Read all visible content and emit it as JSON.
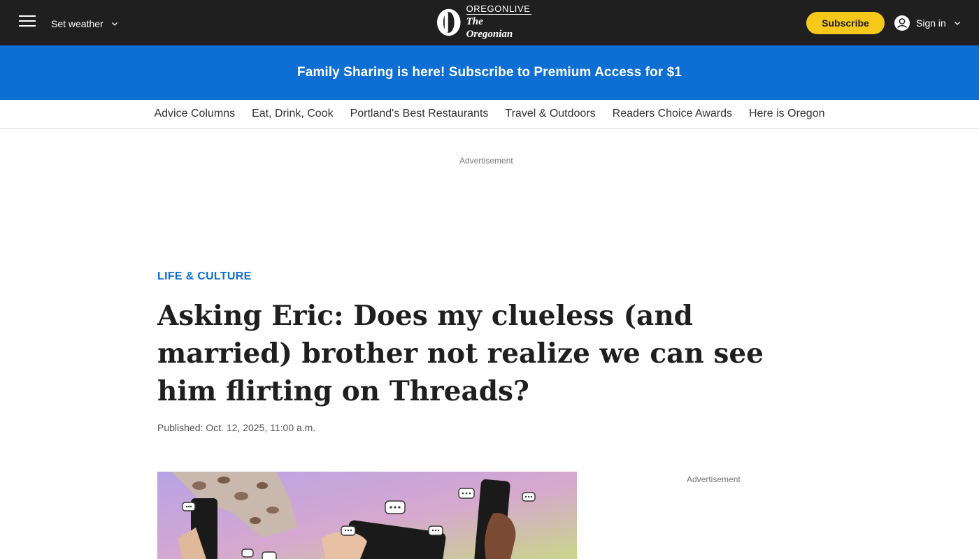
{
  "header": {
    "weather_label": "Set weather",
    "logo_top": "OREGONLIVE",
    "logo_bottom": "The Oregonian",
    "subscribe_label": "Subscribe",
    "signin_label": "Sign in"
  },
  "promo": {
    "text": "Family Sharing is here! Subscribe to Premium Access for $1"
  },
  "nav": {
    "items": [
      {
        "label": "Advice Columns"
      },
      {
        "label": "Eat, Drink, Cook"
      },
      {
        "label": "Portland's Best Restaurants"
      },
      {
        "label": "Travel & Outdoors"
      },
      {
        "label": "Readers Choice Awards"
      },
      {
        "label": "Here is Oregon"
      }
    ]
  },
  "ads": {
    "top_label": "Advertisement",
    "side_label": "Advertisement"
  },
  "article": {
    "kicker": "LIFE & CULTURE",
    "headline": "Asking Eric: Does my clueless (and married) brother not realize we can see him flirting on Threads?",
    "published_label": "Published: ",
    "published_date": "Oct. 12, 2025, 11:00 a.m."
  },
  "icons": {
    "menu": "hamburger-menu-icon",
    "weather_chevron": "chevron-down-icon",
    "user": "user-icon",
    "signin_chevron": "chevron-down-icon",
    "logo": "oregonian-o-logo"
  },
  "colors": {
    "header_bg": "#1f1f1f",
    "accent_blue": "#0d6ed4",
    "subscribe_yellow": "#f6c81a"
  }
}
